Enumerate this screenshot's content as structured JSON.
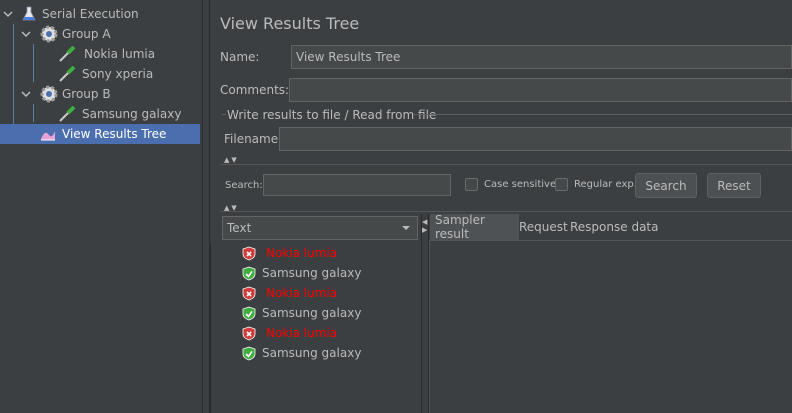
{
  "tree": {
    "items": [
      {
        "label": "Serial Execution",
        "icon": "flask-icon"
      },
      {
        "label": "Group A",
        "icon": "gear-icon"
      },
      {
        "label": "Nokia lumia",
        "icon": "pipette-icon"
      },
      {
        "label": "Sony xperia",
        "icon": "pipette-icon"
      },
      {
        "label": "Group B",
        "icon": "gear-icon"
      },
      {
        "label": "Samsung galaxy",
        "icon": "pipette-icon"
      },
      {
        "label": "View Results Tree",
        "icon": "results-tree-icon"
      }
    ]
  },
  "panel": {
    "title": "View Results Tree",
    "name_label": "Name:",
    "name_value": "View Results Tree",
    "comments_label": "Comments:",
    "comments_value": "",
    "file_section_title": "Write results to file / Read from file",
    "filename_label": "Filename",
    "filename_value": ""
  },
  "search": {
    "label": "Search:",
    "value": "",
    "case_sensitive_label": "Case sensitive",
    "regular_exp_label": "Regular exp.",
    "search_button": "Search",
    "reset_button": "Reset"
  },
  "renderer": {
    "selected": "Text"
  },
  "results": [
    {
      "label": "Nokia lumia",
      "status": "error"
    },
    {
      "label": "Samsung galaxy",
      "status": "success"
    },
    {
      "label": "Nokia lumia",
      "status": "error"
    },
    {
      "label": "Samsung galaxy",
      "status": "success"
    },
    {
      "label": "Nokia lumia",
      "status": "error"
    },
    {
      "label": "Samsung galaxy",
      "status": "success"
    }
  ],
  "tabs": [
    "Sampler result",
    "Request",
    "Response data"
  ],
  "colors": {
    "background": "#3c3f41",
    "selection": "#4b6eaf",
    "error_text": "#ff0000",
    "success_shield": "#3fae3f",
    "error_shield": "#d23b3b"
  }
}
